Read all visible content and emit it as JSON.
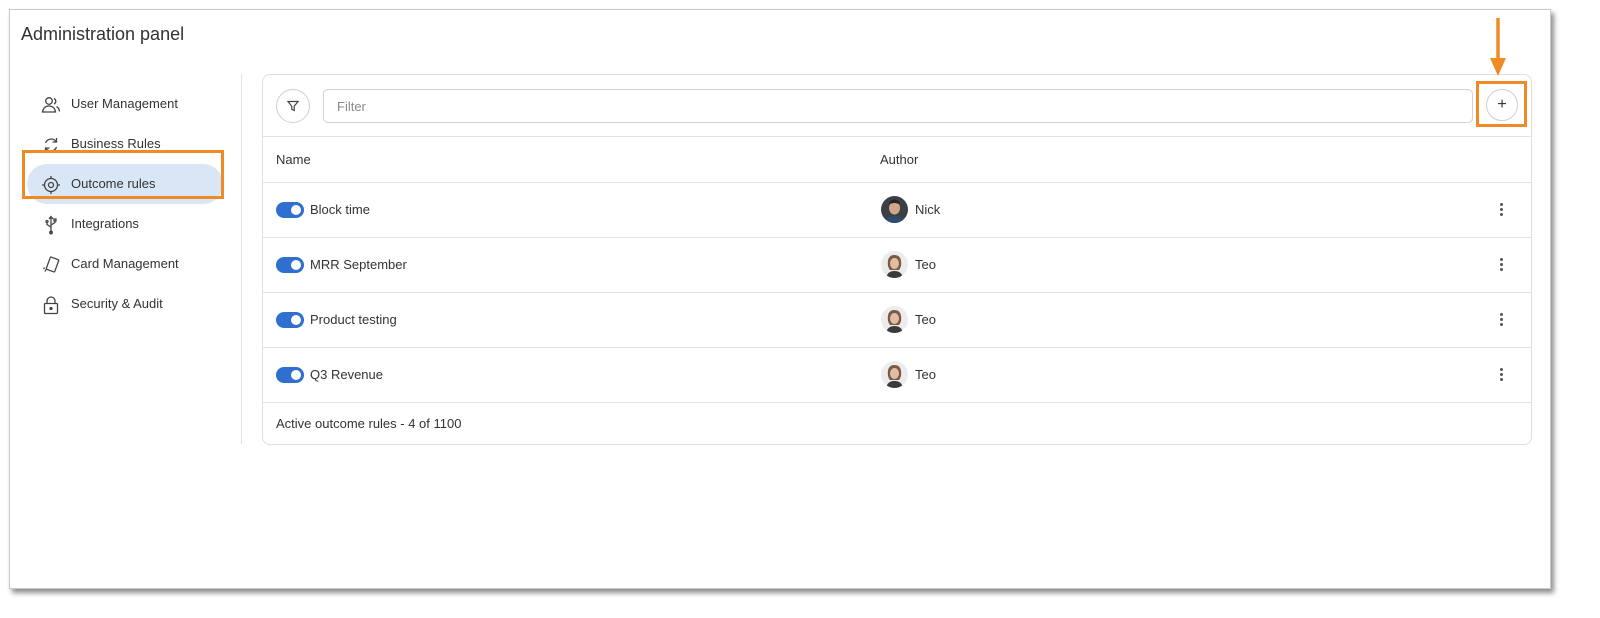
{
  "header": {
    "title": "Administration panel"
  },
  "sidebar": {
    "items": [
      {
        "label": "User Management",
        "icon": "user-management-icon",
        "active": false
      },
      {
        "label": "Business Rules",
        "icon": "refresh-icon",
        "active": false
      },
      {
        "label": "Outcome rules",
        "icon": "target-icon",
        "active": true
      },
      {
        "label": "Integrations",
        "icon": "usb-icon",
        "active": false
      },
      {
        "label": "Card Management",
        "icon": "card-icon",
        "active": false
      },
      {
        "label": "Security & Audit",
        "icon": "lock-icon",
        "active": false
      }
    ]
  },
  "toolbar": {
    "filter_placeholder": "Filter",
    "add_label": "+"
  },
  "table": {
    "columns": [
      "Name",
      "Author"
    ],
    "rows": [
      {
        "name": "Block time",
        "author": "Nick",
        "enabled": true
      },
      {
        "name": "MRR September",
        "author": "Teo",
        "enabled": true
      },
      {
        "name": "Product testing",
        "author": "Teo",
        "enabled": true
      },
      {
        "name": "Q3 Revenue",
        "author": "Teo",
        "enabled": true
      }
    ],
    "footer": "Active outcome rules - 4 of 1100"
  },
  "colors": {
    "accent": "#2f6fd1",
    "highlight": "#f08a24",
    "active_bg": "#d8e6f6"
  }
}
